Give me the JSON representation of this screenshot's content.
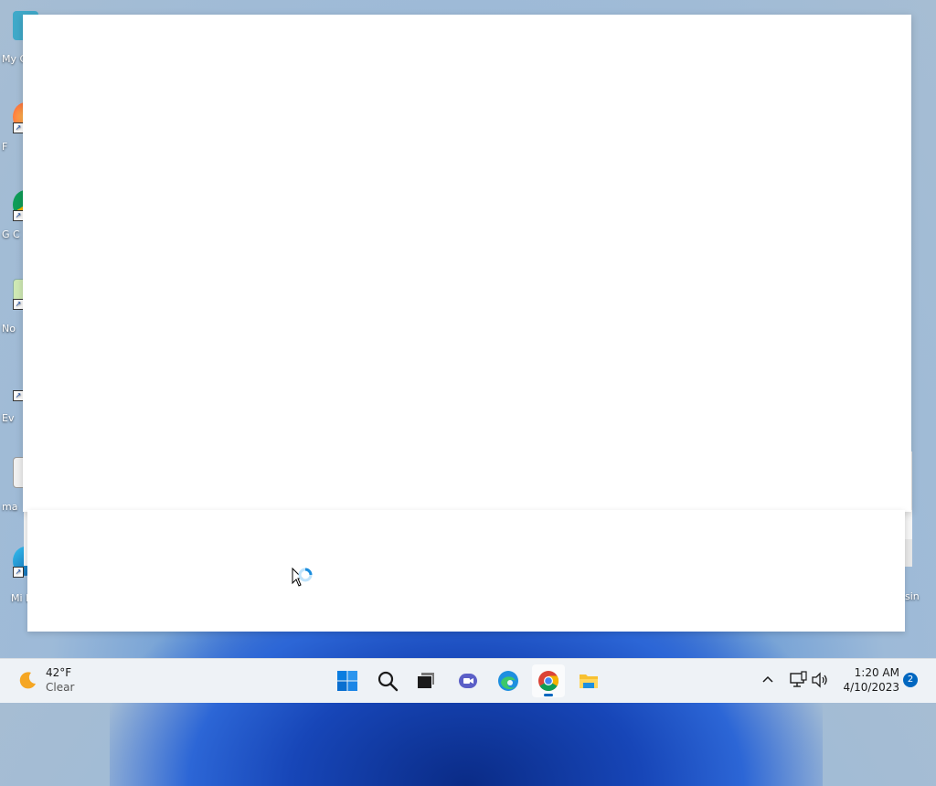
{
  "desktop": {
    "icons": [
      {
        "label": "My C",
        "icon": "computer-icon"
      },
      {
        "label": "F",
        "icon": "firefox-icon"
      },
      {
        "label": "G C",
        "icon": "chrome-icon"
      },
      {
        "label": "No",
        "icon": "notepad-icon"
      },
      {
        "label": "Ev",
        "icon": "everything-icon"
      },
      {
        "label": "ma",
        "icon": "file-icon"
      },
      {
        "label": "Mi E",
        "icon": "edge-icon"
      }
    ],
    "right_label": "sin"
  },
  "taskbar": {
    "weather": {
      "temp": "42°F",
      "condition": "Clear",
      "icon": "moon-icon"
    },
    "apps": [
      {
        "name": "Start",
        "icon": "windows-start-icon"
      },
      {
        "name": "Search",
        "icon": "search-icon"
      },
      {
        "name": "Task View",
        "icon": "task-view-icon"
      },
      {
        "name": "Chat",
        "icon": "teams-chat-icon"
      },
      {
        "name": "Microsoft Edge",
        "icon": "edge-icon"
      },
      {
        "name": "Google Chrome",
        "icon": "chrome-icon",
        "active": true
      },
      {
        "name": "File Explorer",
        "icon": "folder-icon"
      }
    ],
    "tray": {
      "chevron": "chevron-up-icon",
      "network": "network-icon",
      "volume": "volume-icon"
    },
    "clock": {
      "time": "1:20 AM",
      "date": "4/10/2023"
    },
    "notification_count": "2"
  },
  "colors": {
    "accent": "#0067c0",
    "taskbar_bg": "#eef2f6",
    "window_bg": "#ffffff"
  }
}
